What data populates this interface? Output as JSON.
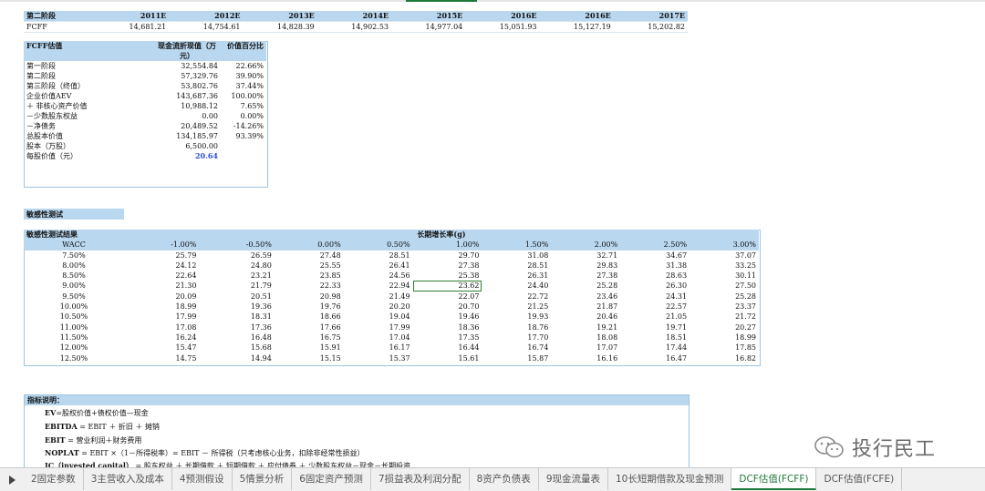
{
  "stage2": {
    "label": "第二阶段",
    "years": [
      "2011E",
      "2012E",
      "2013E",
      "2014E",
      "2015E",
      "2016E",
      "2016E",
      "2017E"
    ],
    "row_label": "FCFF",
    "values": [
      "14,681.21",
      "14,754.61",
      "14,828.39",
      "14,902.53",
      "14,977.04",
      "15,051.93",
      "15,127.19",
      "15,202.82"
    ]
  },
  "fcff": {
    "title": "FCFF估值",
    "col1": "现金流折现值（万元）",
    "col2": "价值百分比",
    "rows": [
      {
        "label": "第一阶段",
        "value": "32,554.84",
        "pct": "22.66%"
      },
      {
        "label": "第二阶段",
        "value": "57,329.76",
        "pct": "39.90%"
      },
      {
        "label": "第三阶段（终值）",
        "value": "53,802.76",
        "pct": "37.44%"
      },
      {
        "label": "企业价值AEV",
        "value": "143,687.36",
        "pct": "100.00%"
      },
      {
        "label": "＋ 非核心资产价值",
        "value": "10,988.12",
        "pct": "7.65%"
      },
      {
        "label": "－少数股东权益",
        "value": "0.00",
        "pct": "0.00%"
      },
      {
        "label": "－净债务",
        "value": "20,489.52",
        "pct": "-14.26%"
      },
      {
        "label": "总股本价值",
        "value": "134,185.97",
        "pct": "93.39%"
      },
      {
        "label": "股本（万股）",
        "value": "6,500.00",
        "pct": ""
      },
      {
        "label": "每股价值（元）",
        "value": "20.64",
        "pct": ""
      }
    ]
  },
  "sensitivity": {
    "title": "敏感性测试",
    "table_title": "敏感性测试结果",
    "growth_label": "长期增长率(g)",
    "wacc_label": "WACC",
    "growth_rates": [
      "-1.00%",
      "-0.50%",
      "0.00%",
      "0.50%",
      "1.00%",
      "1.50%",
      "2.00%",
      "2.50%",
      "3.00%"
    ],
    "rows": [
      {
        "wacc": "7.50%",
        "values": [
          "25.79",
          "26.59",
          "27.48",
          "28.51",
          "29.70",
          "31.08",
          "32.71",
          "34.67",
          "37.07"
        ]
      },
      {
        "wacc": "8.00%",
        "values": [
          "24.12",
          "24.80",
          "25.55",
          "26.41",
          "27.38",
          "28.51",
          "29.83",
          "31.38",
          "33.25"
        ]
      },
      {
        "wacc": "8.50%",
        "values": [
          "22.64",
          "23.21",
          "23.85",
          "24.56",
          "25.38",
          "26.31",
          "27.38",
          "28.63",
          "30.11"
        ]
      },
      {
        "wacc": "9.00%",
        "values": [
          "21.30",
          "21.79",
          "22.33",
          "22.94",
          "23.62",
          "24.40",
          "25.28",
          "26.30",
          "27.50"
        ]
      },
      {
        "wacc": "9.50%",
        "values": [
          "20.09",
          "20.51",
          "20.98",
          "21.49",
          "22.07",
          "22.72",
          "23.46",
          "24.31",
          "25.28"
        ]
      },
      {
        "wacc": "10.00%",
        "values": [
          "18.99",
          "19.36",
          "19.76",
          "20.20",
          "20.70",
          "21.25",
          "21.87",
          "22.57",
          "23.37"
        ]
      },
      {
        "wacc": "10.50%",
        "values": [
          "17.99",
          "18.31",
          "18.66",
          "19.04",
          "19.46",
          "19.93",
          "20.46",
          "21.05",
          "21.72"
        ]
      },
      {
        "wacc": "11.00%",
        "values": [
          "17.08",
          "17.36",
          "17.66",
          "17.99",
          "18.36",
          "18.76",
          "19.21",
          "19.71",
          "20.27"
        ]
      },
      {
        "wacc": "11.50%",
        "values": [
          "16.24",
          "16.48",
          "16.75",
          "17.04",
          "17.35",
          "17.70",
          "18.08",
          "18.51",
          "18.99"
        ]
      },
      {
        "wacc": "12.00%",
        "values": [
          "15.47",
          "15.68",
          "15.91",
          "16.17",
          "16.44",
          "16.74",
          "17.07",
          "17.44",
          "17.85"
        ]
      },
      {
        "wacc": "12.50%",
        "values": [
          "14.75",
          "14.94",
          "15.15",
          "15.37",
          "15.61",
          "15.87",
          "16.16",
          "16.47",
          "16.82"
        ]
      }
    ]
  },
  "notes": {
    "title": "指标说明：",
    "lines": [
      {
        "key": "EV",
        "text": "=股权价值+债权价值—现金"
      },
      {
        "key": "EBITDA",
        "text": " = EBIT ＋ 折旧 ＋ 摊销"
      },
      {
        "key": "EBIT",
        "text": " = 营业利润＋财务费用"
      },
      {
        "key": "NOPLAT",
        "text": " = EBIT ×（1－所得税率）= EBIT － 所得税（只考虑核心业务，扣除非经常性损益）"
      },
      {
        "key": "IC（invested capital）",
        "text": " = 股东权益 ＋ 长期借款 ＋ 短期借款 ＋ 应付债券 ＋ 少数股东权益－现金－长期投资"
      }
    ]
  },
  "watermark": {
    "text": "投行民工",
    "icon": "wechat-icon"
  },
  "tabs": [
    "2固定参数",
    "3主营收入及成本",
    "4预测假设",
    "5情景分析",
    "6固定资产预测",
    "7损益表及利润分配",
    "8资产负债表",
    "9现金流量表",
    "10长短期借款及现金预测",
    "DCF估值(FCFF)",
    "DCF估值(FCFE)"
  ],
  "active_tab": "DCF估值(FCFF)",
  "colors": {
    "header_fill": "#b9d7ef",
    "border": "#9fc3dd",
    "active_tab": "#1f7a3a",
    "value_highlight": "#2b4fd6"
  }
}
